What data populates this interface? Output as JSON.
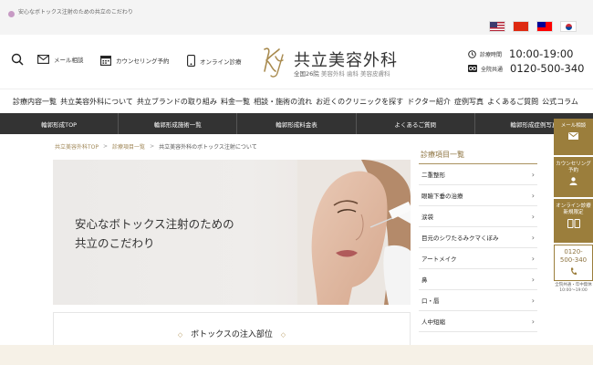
{
  "topbar": {
    "notice": "安心なボトックス注射のための共立のこだわり",
    "flags": [
      "us",
      "cn",
      "tw",
      "kr"
    ]
  },
  "header": {
    "mail_label": "メール相談",
    "counseling_label": "カウンセリング予約",
    "online_label": "オンライン診療",
    "logo_name": "共立美容外科",
    "logo_sub_1": "全国26院",
    "logo_sub_2": "美容外科",
    "logo_sub_3": "歯科",
    "logo_sub_4": "美容皮膚科",
    "hours_label": "診療時間",
    "hours_value": "10:00-19:00",
    "phone_label": "全院共通",
    "phone_value": "0120-500-340"
  },
  "main_nav": [
    "診療内容一覧",
    "共立美容外科について",
    "共立ブランドの取り組み",
    "料金一覧",
    "相談・施術の流れ",
    "お近くのクリニックを探す",
    "ドクター紹介",
    "症例写真",
    "よくあるご質問",
    "公式コラム"
  ],
  "sub_nav": [
    "輪郭形成TOP",
    "輪郭形成施術一覧",
    "輪郭形成料金表",
    "よくあるご質問",
    "輪郭形成症例写真"
  ],
  "breadcrumb": {
    "item1": "共立美容外科TOP",
    "item2": "診療項目一覧",
    "current": "共立美容外科のボトックス注射について",
    "separator": ">"
  },
  "hero": {
    "line1": "安心なボトックス注射のための",
    "line2": "共立のこだわり"
  },
  "section": {
    "title": "ボトックスの注入部位",
    "ornament": "◇"
  },
  "sidebar": {
    "heading": "診療項目一覧",
    "items": [
      "二重整形",
      "眼瞼下垂の治療",
      "涙袋",
      "目元のシワたるみクマくぼみ",
      "アートメイク",
      "鼻",
      "口・唇",
      "人中短縮"
    ],
    "chevron": "›"
  },
  "floating": {
    "mail": "メール相談",
    "counsel_1": "カウンセリング",
    "counsel_2": "予約",
    "online_1": "オンライン診療",
    "online_2": "新規限定",
    "phone_1": "0120-",
    "phone_2": "500-340",
    "note_1": "全院共通・年中無休",
    "note_2": "10:00〜19:00"
  },
  "colors": {
    "gold": "#9b7e3c",
    "dark_nav": "#333333",
    "accent_text": "#8e7441"
  }
}
